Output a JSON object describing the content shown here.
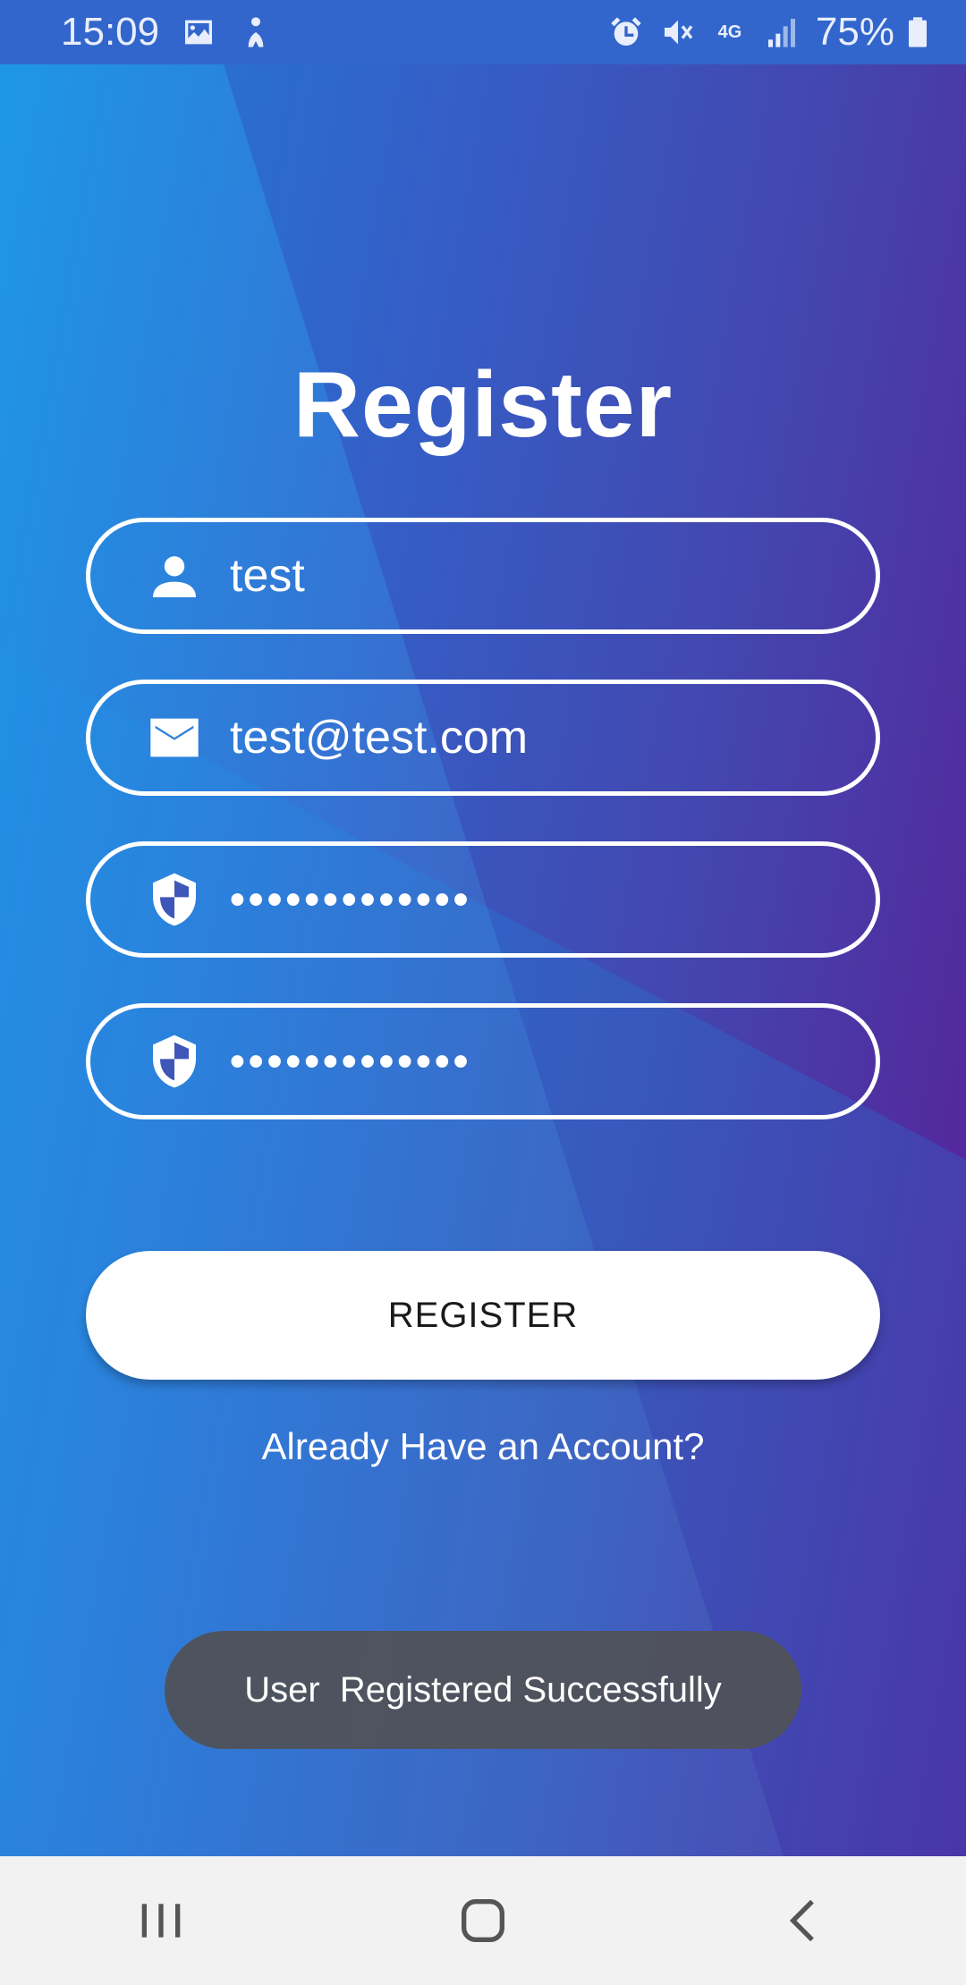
{
  "status_bar": {
    "time": "15:09",
    "battery": "75%",
    "network": "4G",
    "left_icons": [
      "image-icon",
      "notification-app-icon"
    ],
    "right_icons": [
      "alarm-icon",
      "mute-icon",
      "4g-icon",
      "signal-icon",
      "battery-icon"
    ]
  },
  "screen": {
    "title": "Register",
    "fields": [
      {
        "icon": "person-icon",
        "value": "test"
      },
      {
        "icon": "email-icon",
        "value": "test@test.com"
      },
      {
        "icon": "shield-icon",
        "value": "•••••••••••••"
      },
      {
        "icon": "shield-icon",
        "value": "•••••••••••••"
      }
    ],
    "register_label": "REGISTER",
    "login_link": "Already Have an Account?",
    "toast": "User  Registered Successfully"
  },
  "nav_bar": {
    "buttons": [
      "recents-icon",
      "home-icon",
      "back-icon"
    ]
  },
  "colors": {
    "status_bar": "#3366cc",
    "gradient_start": "#1593e6",
    "gradient_end": "#5a1d96",
    "button_bg": "#ffffff",
    "toast_bg": "#505258",
    "nav_bar": "#f2f2f2"
  }
}
